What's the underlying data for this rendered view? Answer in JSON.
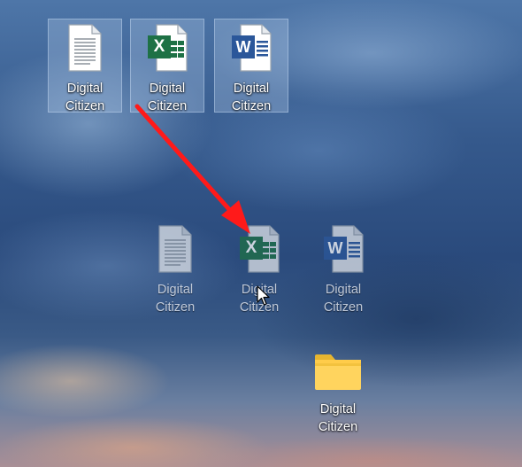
{
  "desktop": {
    "selected_icons": [
      {
        "type": "text-document",
        "icon": "text-document-icon",
        "label": "Digital\nCitizen"
      },
      {
        "type": "excel-document",
        "icon": "excel-icon",
        "label": "Digital\nCitizen"
      },
      {
        "type": "word-document",
        "icon": "word-icon",
        "label": "Digital\nCitizen"
      }
    ],
    "drag_icons": [
      {
        "type": "text-document",
        "icon": "text-document-icon",
        "label": "Digital\nCitizen"
      },
      {
        "type": "excel-document",
        "icon": "excel-icon",
        "label": "Digital\nCitizen"
      },
      {
        "type": "word-document",
        "icon": "word-icon",
        "label": "Digital\nCitizen"
      }
    ],
    "folder": {
      "icon": "folder-icon",
      "label": "Digital\nCitizen"
    },
    "excel_letter": "X",
    "word_letter": "W",
    "colors": {
      "excel_green": "#1e7145",
      "word_blue": "#2b579a",
      "folder_yellow": "#ffd45e",
      "arrow_red": "#ff1a1a",
      "selection_fill": "rgba(170,195,225,0.35)"
    }
  },
  "annotation": {
    "type": "red-arrow",
    "meaning": "drag selected icons"
  },
  "cursor": {
    "icon": "mouse-pointer-icon"
  }
}
